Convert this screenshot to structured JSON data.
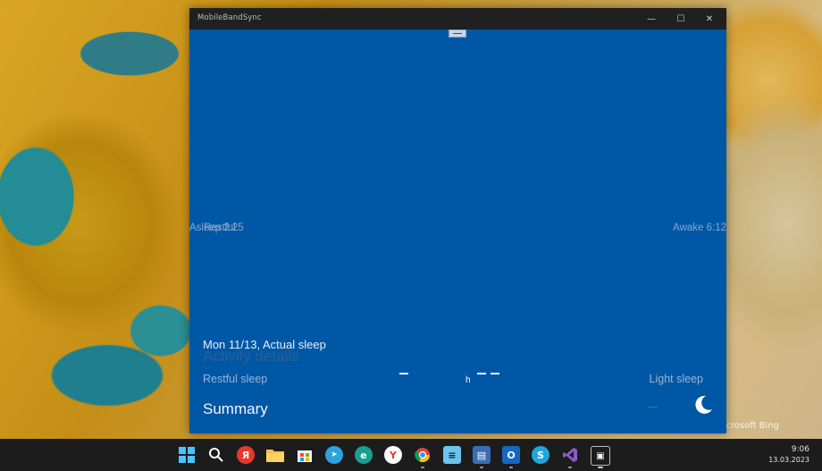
{
  "window": {
    "title": "MobileBandSync",
    "controls": {
      "minimize": "—",
      "maximize": "☐",
      "close": "✕"
    }
  },
  "sleep_chart": {
    "asleep_label": "Asleep 2:25",
    "overlap_label": "Restful",
    "awake_label": "Awake 6:12"
  },
  "details": {
    "date_line": "Mon 11/13, Actual sleep",
    "activity_heading": "Activity details",
    "restful_label": "Restful sleep",
    "light_label": "Light sleep",
    "hour_unit": "h",
    "summary_label": "Summary"
  },
  "taskbar": {
    "icons": [
      {
        "name": "start-icon",
        "glyph": "",
        "color": "#4cc2ff"
      },
      {
        "name": "search-icon",
        "glyph": "",
        "color": "transparent"
      },
      {
        "name": "yandex-icon",
        "glyph": "Я",
        "color": "#e8372c"
      },
      {
        "name": "file-explorer-icon",
        "glyph": "",
        "color": "#f2c14e"
      },
      {
        "name": "store-icon",
        "glyph": "",
        "color": "#ffffff"
      },
      {
        "name": "telegram-icon",
        "glyph": "➤",
        "color": "#2aa3e0"
      },
      {
        "name": "edge-icon",
        "glyph": "e",
        "color": "#1a9e8f"
      },
      {
        "name": "yandex-browser-icon",
        "glyph": "Y",
        "color": "#e8372c"
      },
      {
        "name": "chrome-icon",
        "glyph": "",
        "color": "#e8a33c"
      },
      {
        "name": "notepad-icon",
        "glyph": "≡",
        "color": "#6cc3ef"
      },
      {
        "name": "floppy-app-icon",
        "glyph": "▤",
        "color": "#3a6db5"
      },
      {
        "name": "outlook-icon",
        "glyph": "O",
        "color": "#1468c0"
      },
      {
        "name": "skype-icon",
        "glyph": "S",
        "color": "#1ea6e0"
      },
      {
        "name": "visual-studio-icon",
        "glyph": "",
        "color": "#8a5cc7"
      },
      {
        "name": "band-sync-icon",
        "glyph": "▣",
        "color": "#2a2a2a"
      }
    ],
    "clock_time": "9:06",
    "clock_date": "13.03.2023"
  },
  "wallpaper": {
    "credit": "icrosoft Bing"
  },
  "colors": {
    "app_background": "#0057a6",
    "titlebar": "#202020",
    "taskbar": "#1c1c1c"
  }
}
